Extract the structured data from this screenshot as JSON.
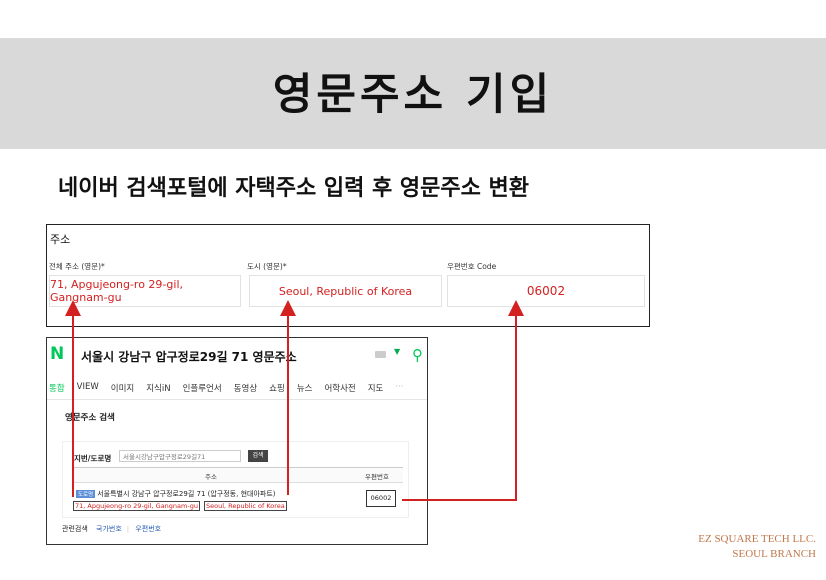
{
  "slide": {
    "title": "영문주소 기입",
    "subtitle": "네이버 검색포털에 자택주소 입력 후 영문주소 변환"
  },
  "form": {
    "heading": "주소",
    "label_address": "전체 주소 (영문)*",
    "label_city": "도시 (영문)*",
    "label_zip": "우편번호 Code",
    "value_address": "71, Apgujeong-ro 29-gil, Gangnam-gu",
    "value_city": "Seoul, Republic of Korea",
    "value_zip": "06002"
  },
  "naver": {
    "logo": "N",
    "query": "서울시 강남구 압구정로29길 71 영문주소",
    "tabs": [
      "통합",
      "VIEW",
      "이미지",
      "지식iN",
      "인플루언서",
      "동영상",
      "쇼핑",
      "뉴스",
      "어학사전",
      "지도"
    ],
    "tabs_more": "···",
    "section_title": "영문주소 검색",
    "search_label": "지번/도로명",
    "search_value": "서울시강남구압구정로29길71",
    "search_button": "검색",
    "col_address": "주소",
    "col_zip": "우편번호",
    "result_badge": "도로명",
    "result_korean": "서울특별시 강남구 압구정로29길 71 (압구정동, 현대아파트)",
    "result_english_street": "71, Apgujeong-ro 29-gil, Gangnam-gu",
    "result_english_city": "Seoul, Republic of Korea",
    "result_zip": "06002",
    "related_label": "관련검색",
    "related_links": [
      "국가번호",
      "우편번호"
    ]
  },
  "brand": {
    "line1": "EZ SQUARE TECH LLC.",
    "line2": "SEOUL BRANCH"
  },
  "colors": {
    "banner": "#d9d9d9",
    "accent_red": "#d32020",
    "naver_green": "#03c75a",
    "brand": "#c0784a"
  }
}
